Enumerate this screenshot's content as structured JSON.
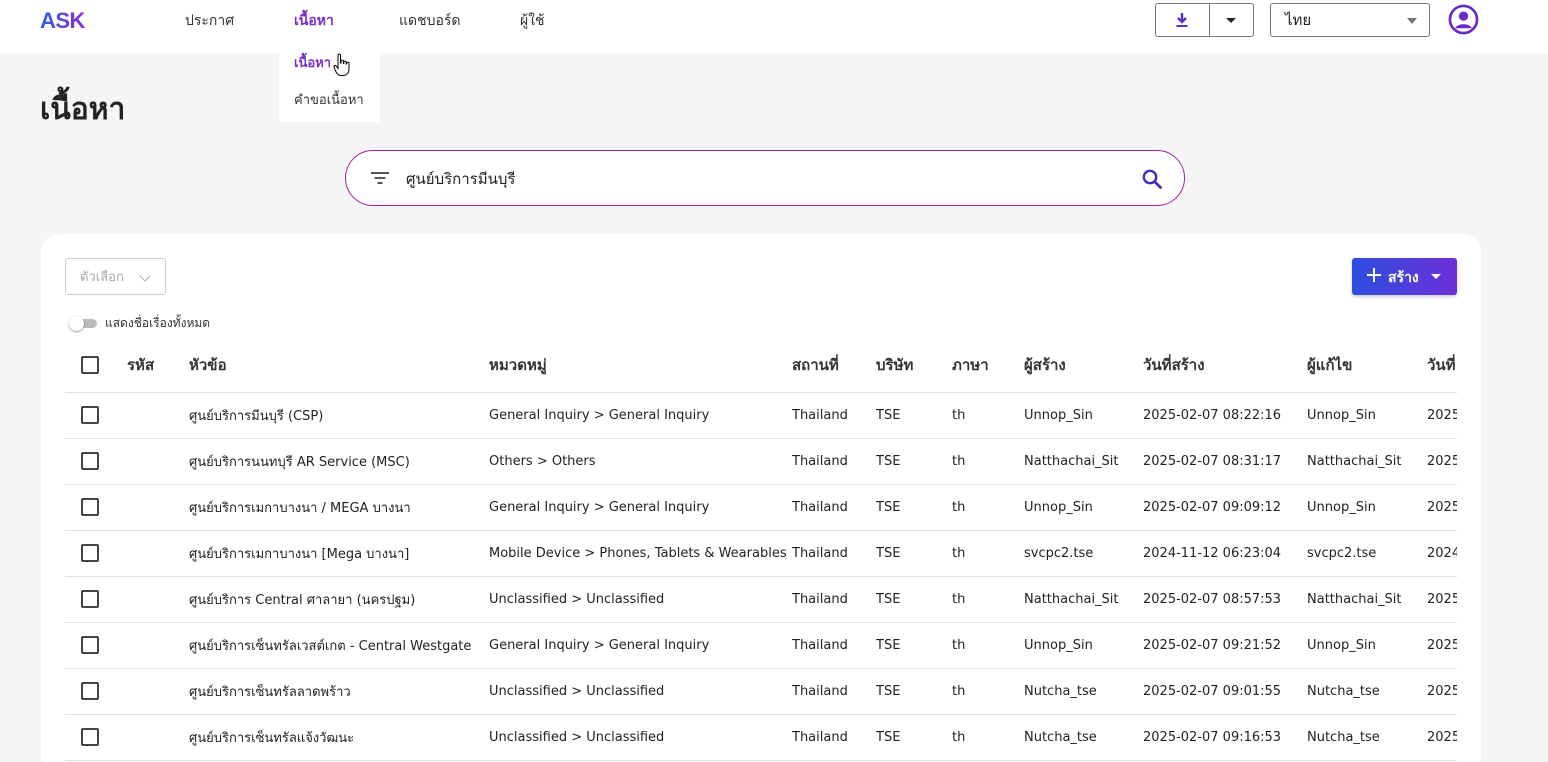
{
  "header": {
    "logo": "ASK",
    "nav": [
      "ประกาศ",
      "เนื้อหา",
      "แดชบอร์ด",
      "ผู้ใช้"
    ],
    "nav_active": 1,
    "language": "ไทย",
    "download_icon": "download-icon",
    "avatar_icon": "user-circle-icon"
  },
  "dropdown": {
    "items": [
      "เนื้อหา",
      "คำขอเนื้อหา"
    ]
  },
  "page": {
    "title": "เนื้อหา"
  },
  "search": {
    "value": "ศูนย์บริการมีนบุรี",
    "filter_icon": "filter-icon",
    "search_icon": "search-icon"
  },
  "toolbar": {
    "options_label": "ตัวเลือก",
    "toggle_label": "แสดงชื่อเรื่องทั้งหมด",
    "create_label": "สร้าง"
  },
  "table": {
    "columns": [
      "รหัส",
      "หัวข้อ",
      "หมวดหมู่",
      "สถานที่",
      "บริษัท",
      "ภาษา",
      "ผู้สร้าง",
      "วันที่สร้าง",
      "ผู้แก้ไข",
      "วันที่"
    ],
    "rows": [
      [
        "",
        "ศูนย์บริการมีนบุรี (CSP)",
        "General Inquiry > General Inquiry",
        "Thailand",
        "TSE",
        "th",
        "Unnop_Sin",
        "2025-02-07 08:22:16",
        "Unnop_Sin",
        "2025"
      ],
      [
        "",
        "ศูนย์บริการนนทบุรี AR Service (MSC)",
        "Others > Others",
        "Thailand",
        "TSE",
        "th",
        "Natthachai_Sit",
        "2025-02-07 08:31:17",
        "Natthachai_Sit",
        "2025"
      ],
      [
        "",
        "ศูนย์บริการเมกาบางนา / MEGA บางนา",
        "General Inquiry > General Inquiry",
        "Thailand",
        "TSE",
        "th",
        "Unnop_Sin",
        "2025-02-07 09:09:12",
        "Unnop_Sin",
        "2025"
      ],
      [
        "",
        "ศูนย์บริการเมกาบางนา [Mega บางนา]",
        "Mobile Device > Phones, Tablets & Wearables",
        "Thailand",
        "TSE",
        "th",
        "svcpc2.tse",
        "2024-11-12 06:23:04",
        "svcpc2.tse",
        "2024"
      ],
      [
        "",
        "ศูนย์บริการ Central ศาลายา (นครปฐม)",
        "Unclassified > Unclassified",
        "Thailand",
        "TSE",
        "th",
        "Natthachai_Sit",
        "2025-02-07 08:57:53",
        "Natthachai_Sit",
        "2025"
      ],
      [
        "",
        "ศูนย์บริการเซ็นทรัลเวสต์เกต - Central Westgate",
        "General Inquiry > General Inquiry",
        "Thailand",
        "TSE",
        "th",
        "Unnop_Sin",
        "2025-02-07 09:21:52",
        "Unnop_Sin",
        "2025"
      ],
      [
        "",
        "ศูนย์บริการเซ็นทรัลลาดพร้าว",
        "Unclassified > Unclassified",
        "Thailand",
        "TSE",
        "th",
        "Nutcha_tse",
        "2025-02-07 09:01:55",
        "Nutcha_tse",
        "2025"
      ],
      [
        "",
        "ศูนย์บริการเซ็นทรัลแจ้งวัฒนะ",
        "Unclassified > Unclassified",
        "Thailand",
        "TSE",
        "th",
        "Nutcha_tse",
        "2025-02-07 09:16:53",
        "Nutcha_tse",
        "2025"
      ]
    ]
  }
}
